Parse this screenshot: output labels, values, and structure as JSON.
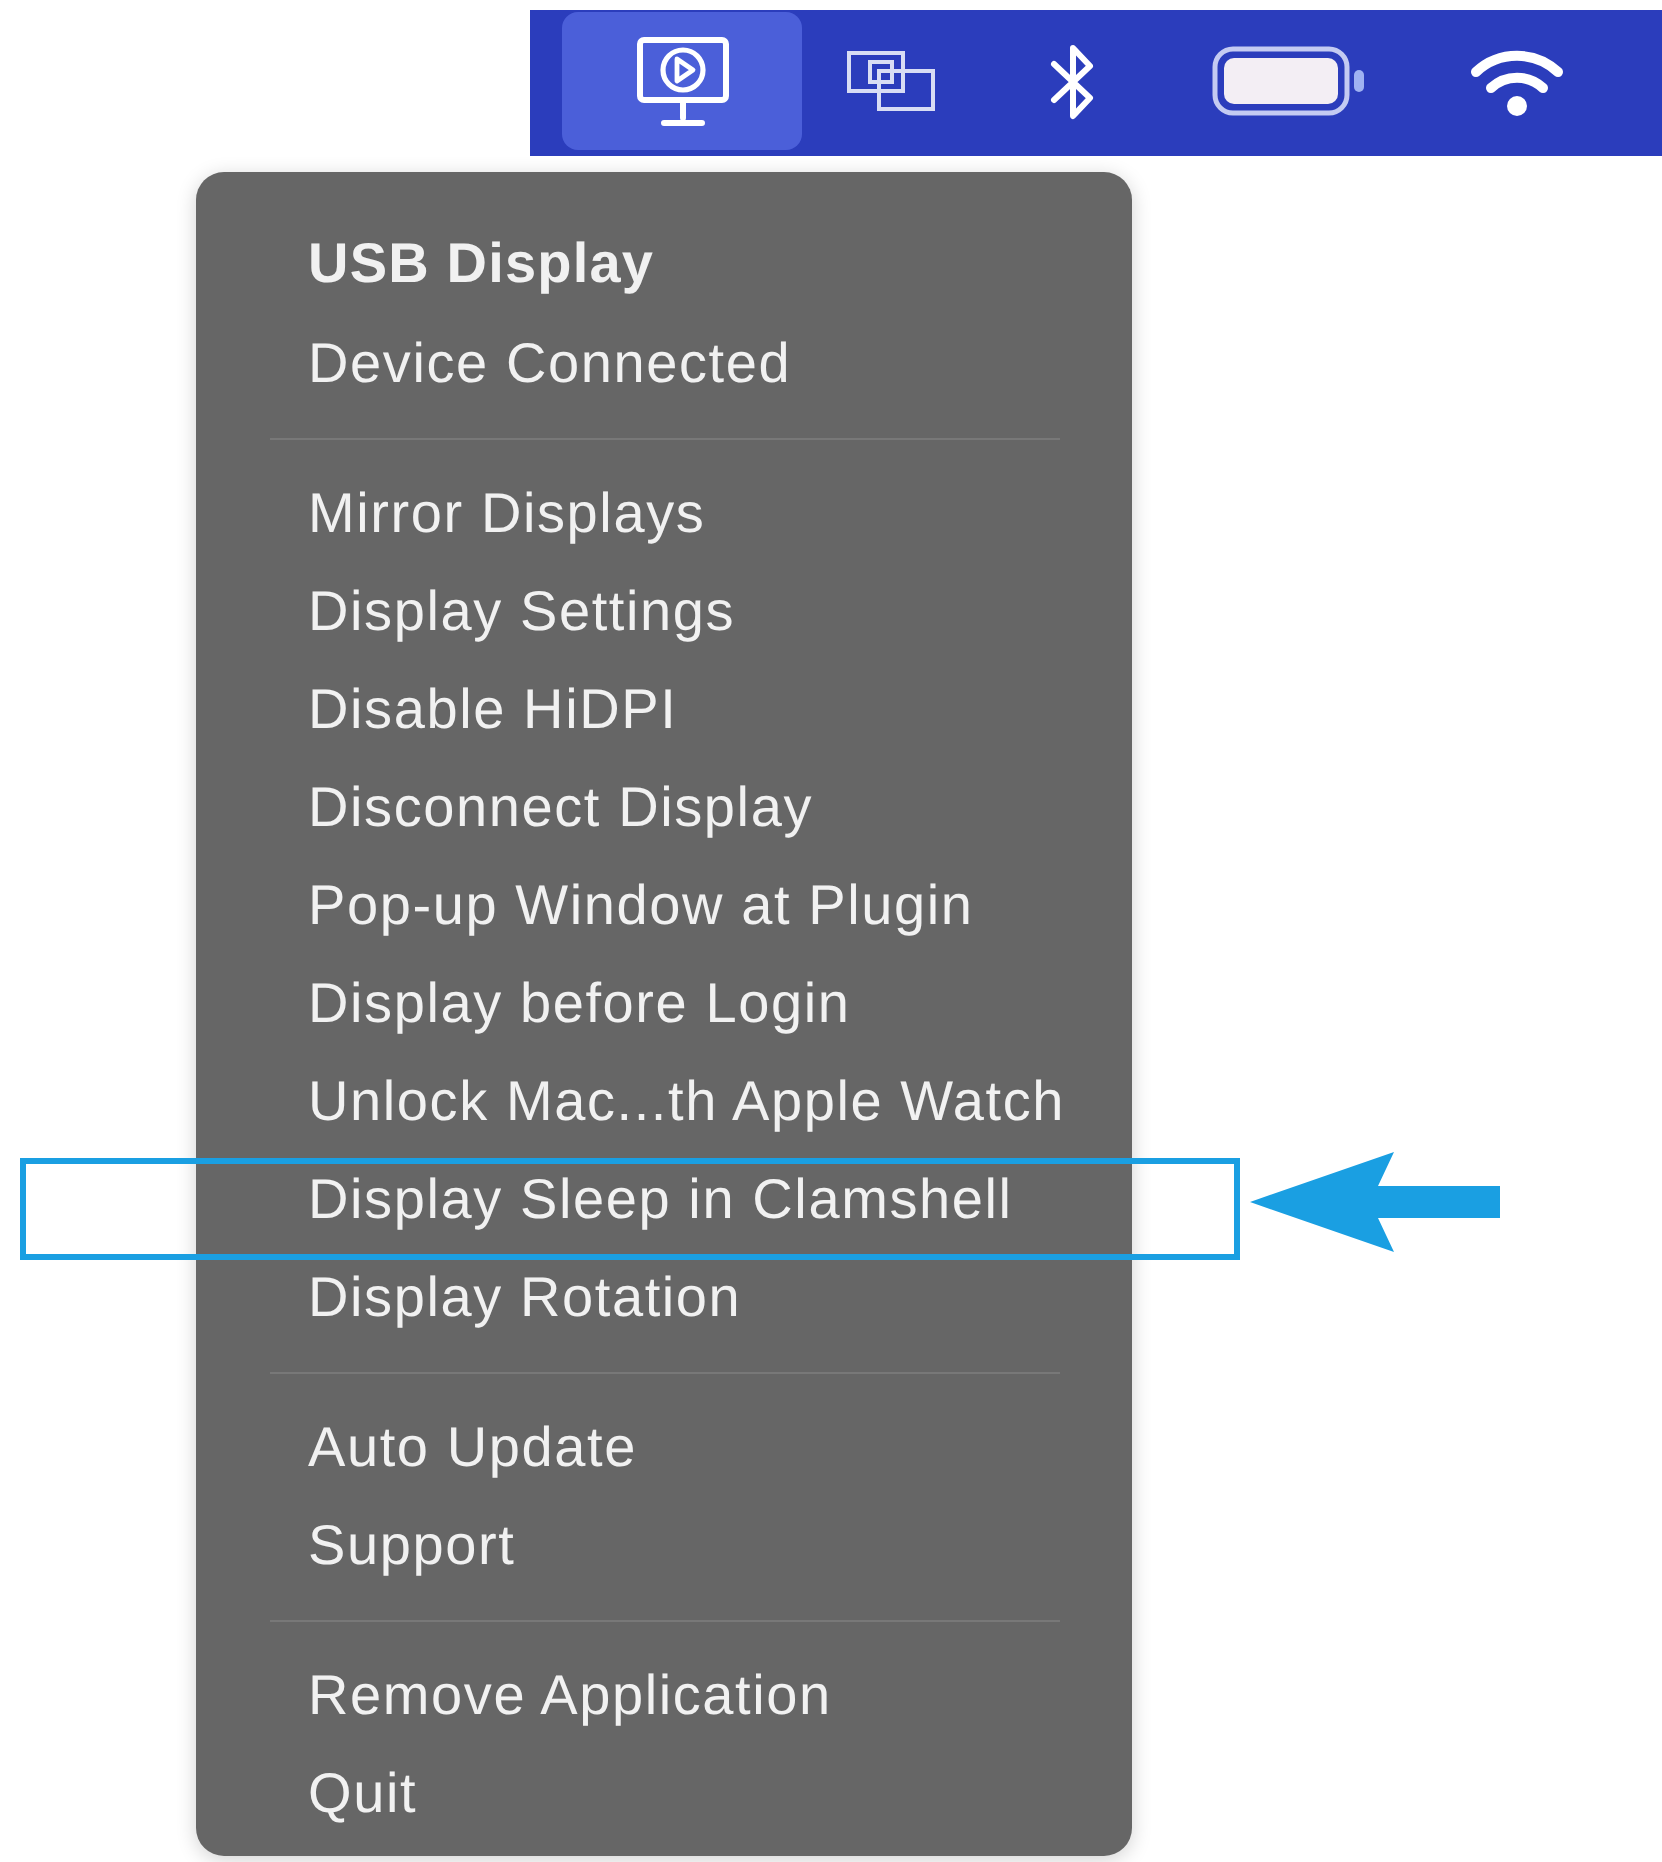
{
  "menu_bar": {
    "items": [
      {
        "kind": "display",
        "selected": true
      },
      {
        "kind": "windows",
        "selected": false
      },
      {
        "kind": "bluetooth",
        "selected": false
      },
      {
        "kind": "battery",
        "selected": false
      },
      {
        "kind": "wifi",
        "selected": false
      }
    ]
  },
  "menu": {
    "sections": [
      {
        "items": [
          {
            "kind": "header",
            "label": "USB Display",
            "highlighted": false
          },
          {
            "kind": "status",
            "label": "Device Connected",
            "highlighted": false
          }
        ]
      },
      {
        "items": [
          {
            "kind": "action",
            "label": "Mirror Displays",
            "highlighted": false
          },
          {
            "kind": "action",
            "label": "Display Settings",
            "highlighted": false
          },
          {
            "kind": "action",
            "label": "Disable HiDPI",
            "highlighted": false
          },
          {
            "kind": "action",
            "label": "Disconnect Display",
            "highlighted": false
          },
          {
            "kind": "action",
            "label": "Pop-up Window at Plugin",
            "highlighted": false
          },
          {
            "kind": "action",
            "label": "Display before Login",
            "highlighted": false
          },
          {
            "kind": "action",
            "label": "Unlock Mac...th Apple Watch",
            "highlighted": false
          },
          {
            "kind": "action",
            "label": "Display Sleep in Clamshell",
            "highlighted": true
          },
          {
            "kind": "action",
            "label": "Display Rotation",
            "highlighted": false
          }
        ]
      },
      {
        "items": [
          {
            "kind": "action",
            "label": "Auto Update",
            "highlighted": false
          },
          {
            "kind": "action",
            "label": "Support",
            "highlighted": false
          }
        ]
      },
      {
        "items": [
          {
            "kind": "action",
            "label": "Remove Application",
            "highlighted": false
          },
          {
            "kind": "action",
            "label": "Quit",
            "highlighted": false
          }
        ]
      }
    ]
  }
}
